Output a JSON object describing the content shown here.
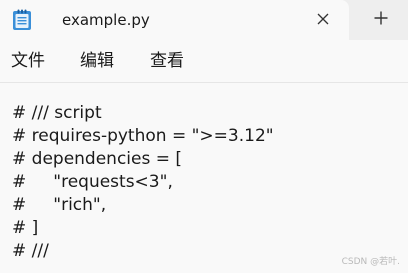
{
  "tab": {
    "title": "example.py",
    "app_icon": "notepad-icon",
    "close_icon": "close-icon",
    "new_tab_icon": "plus-icon"
  },
  "menu": {
    "items": [
      "文件",
      "编辑",
      "查看"
    ]
  },
  "editor": {
    "lines": [
      "# /// script",
      "# requires-python = \">=3.12\"",
      "# dependencies = [",
      "#     \"requests<3\",",
      "#     \"rich\",",
      "# ]",
      "# ///"
    ]
  },
  "watermark": "CSDN @若叶."
}
